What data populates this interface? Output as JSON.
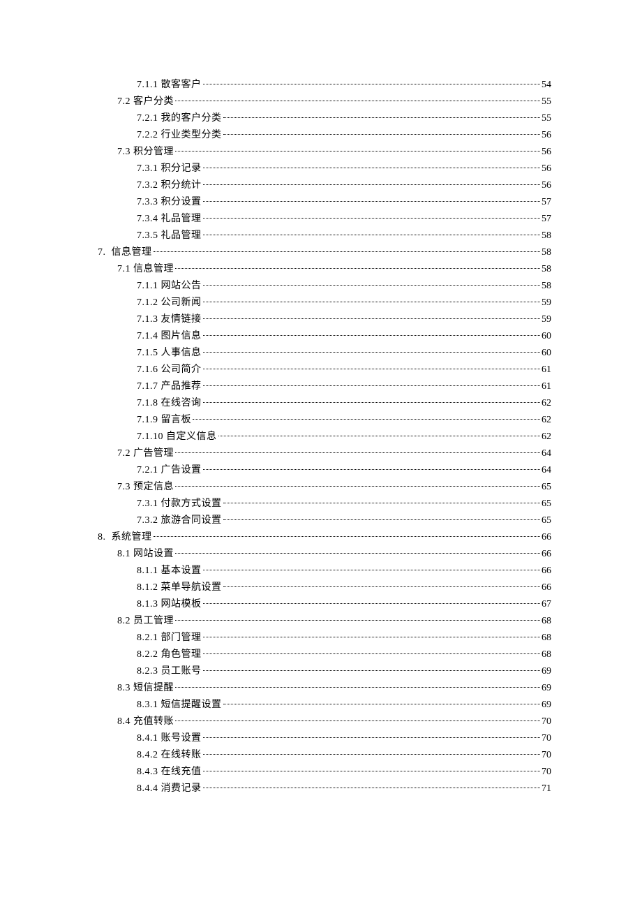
{
  "toc": [
    {
      "level": 3,
      "num": "7.1.1",
      "title": "散客客户",
      "page": "54"
    },
    {
      "level": 2,
      "num": "7.2",
      "title": "客户分类",
      "page": "55"
    },
    {
      "level": 3,
      "num": "7.2.1",
      "title": "我的客户分类",
      "page": "55"
    },
    {
      "level": 3,
      "num": "7.2.2",
      "title": "行业类型分类",
      "page": "56"
    },
    {
      "level": 2,
      "num": "7.3",
      "title": "积分管理",
      "page": "56"
    },
    {
      "level": 3,
      "num": "7.3.1",
      "title": "积分记录",
      "page": "56"
    },
    {
      "level": 3,
      "num": "7.3.2",
      "title": "积分统计",
      "page": "56"
    },
    {
      "level": 3,
      "num": "7.3.3",
      "title": "积分设置",
      "page": "57"
    },
    {
      "level": 3,
      "num": "7.3.4",
      "title": "礼品管理",
      "page": "57"
    },
    {
      "level": 3,
      "num": "7.3.5",
      "title": "礼品管理",
      "page": "58"
    },
    {
      "level": 1,
      "num": "7.",
      "title": "信息管理",
      "page": "58"
    },
    {
      "level": 2,
      "num": "7.1",
      "title": "信息管理",
      "page": "58"
    },
    {
      "level": 3,
      "num": "7.1.1",
      "title": "网站公告",
      "page": "58"
    },
    {
      "level": 3,
      "num": "7.1.2",
      "title": "公司新闻",
      "page": "59"
    },
    {
      "level": 3,
      "num": "7.1.3",
      "title": "友情链接",
      "page": "59"
    },
    {
      "level": 3,
      "num": "7.1.4",
      "title": "图片信息",
      "page": "60"
    },
    {
      "level": 3,
      "num": "7.1.5",
      "title": "人事信息",
      "page": "60"
    },
    {
      "level": 3,
      "num": "7.1.6",
      "title": "公司简介",
      "page": "61"
    },
    {
      "level": 3,
      "num": "7.1.7",
      "title": "产品推荐",
      "page": "61"
    },
    {
      "level": 3,
      "num": "7.1.8",
      "title": "在线咨询",
      "page": "62"
    },
    {
      "level": 3,
      "num": "7.1.9",
      "title": "留言板",
      "page": "62"
    },
    {
      "level": 3,
      "num": "7.1.10",
      "title": "自定义信息",
      "page": "62"
    },
    {
      "level": 2,
      "num": "7.2",
      "title": "广告管理",
      "page": "64"
    },
    {
      "level": 3,
      "num": "7.2.1",
      "title": "广告设置",
      "page": "64"
    },
    {
      "level": 2,
      "num": "7.3",
      "title": "预定信息",
      "page": "65"
    },
    {
      "level": 3,
      "num": "7.3.1",
      "title": "付款方式设置",
      "page": "65"
    },
    {
      "level": 3,
      "num": "7.3.2",
      "title": "旅游合同设置",
      "page": "65"
    },
    {
      "level": 1,
      "num": "8.",
      "title": "系统管理",
      "page": "66"
    },
    {
      "level": 2,
      "num": "8.1",
      "title": "网站设置",
      "page": "66"
    },
    {
      "level": 3,
      "num": "8.1.1",
      "title": "基本设置",
      "page": "66"
    },
    {
      "level": 3,
      "num": "8.1.2",
      "title": "菜单导航设置",
      "page": "66"
    },
    {
      "level": 3,
      "num": "8.1.3",
      "title": "网站模板",
      "page": "67"
    },
    {
      "level": 2,
      "num": "8.2",
      "title": "员工管理",
      "page": "68"
    },
    {
      "level": 3,
      "num": "8.2.1",
      "title": "部门管理",
      "page": "68"
    },
    {
      "level": 3,
      "num": "8.2.2",
      "title": "角色管理",
      "page": "68"
    },
    {
      "level": 3,
      "num": "8.2.3",
      "title": "员工账号",
      "page": "69"
    },
    {
      "level": 2,
      "num": "8.3",
      "title": "短信提醒",
      "page": "69"
    },
    {
      "level": 3,
      "num": "8.3.1",
      "title": "短信提醒设置",
      "page": "69"
    },
    {
      "level": 2,
      "num": "8.4",
      "title": "充值转账",
      "page": "70"
    },
    {
      "level": 3,
      "num": "8.4.1",
      "title": "账号设置",
      "page": "70"
    },
    {
      "level": 3,
      "num": "8.4.2",
      "title": "在线转账",
      "page": "70"
    },
    {
      "level": 3,
      "num": "8.4.3",
      "title": "在线充值",
      "page": "70"
    },
    {
      "level": 3,
      "num": "8.4.4",
      "title": "消费记录",
      "page": "71"
    }
  ]
}
